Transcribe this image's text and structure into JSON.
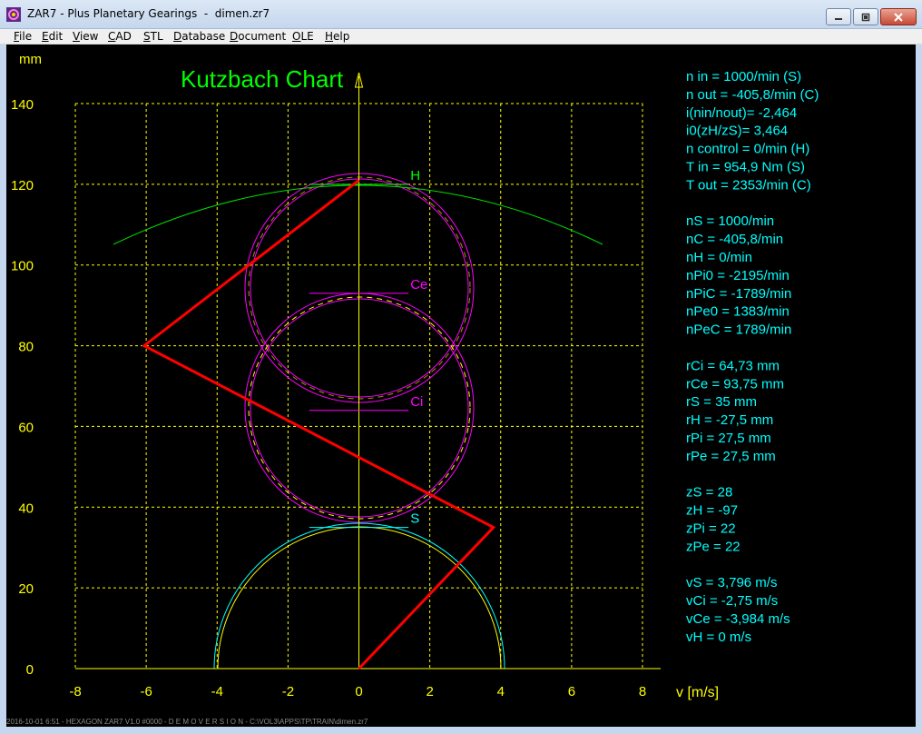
{
  "window": {
    "title": "ZAR7 - Plus Planetary Gearings  -  dimen.zr7",
    "icon": "app-icon",
    "controls": [
      "minimize-icon",
      "maximize-icon",
      "close-icon"
    ]
  },
  "menu": [
    "File",
    "Edit",
    "View",
    "CAD",
    "STL",
    "Database",
    "Document",
    "OLE",
    "Help"
  ],
  "chart_data": {
    "type": "line",
    "title": "Kutzbach Chart",
    "xlabel": "v [m/s]",
    "ylabel": "mm",
    "xlim": [
      -8,
      8
    ],
    "ylim": [
      0,
      140
    ],
    "xticks": [
      -8,
      -6,
      -4,
      -2,
      0,
      2,
      4,
      6,
      8
    ],
    "yticks": [
      0,
      20,
      40,
      60,
      80,
      100,
      120,
      140
    ],
    "grid": true,
    "series": [
      {
        "name": "",
        "color": "#ff0000",
        "points": [
          [
            0,
            0
          ],
          [
            3.796,
            35
          ],
          [
            -6.06,
            80
          ],
          [
            0,
            121
          ]
        ]
      }
    ],
    "labels": [
      {
        "text": "H",
        "color": "#00ff00",
        "x": 1.4,
        "y": 122
      },
      {
        "text": "Ce",
        "color": "#ff00ff",
        "x": 1.4,
        "y": 95
      },
      {
        "text": "Ci",
        "color": "#ff00ff",
        "x": 1.4,
        "y": 66
      },
      {
        "text": "S",
        "color": "#00ffff",
        "x": 1.4,
        "y": 37
      }
    ],
    "colors": {
      "grid": "#ffff00",
      "axes": "#ffff00",
      "title": "#00ff00",
      "info": "#00ffff"
    }
  },
  "info": {
    "group1": [
      "n in = 1000/min (S)",
      "n out = -405,8/min (C)",
      "i(nin/nout)= -2,464",
      "i0(zH/zS)= 3,464",
      "n control = 0/min (H)",
      "T in = 954,9 Nm (S)",
      "T out = 2353/min (C)"
    ],
    "group2": [
      "nS = 1000/min",
      "nC = -405,8/min",
      "nH = 0/min",
      "nPi0 = -2195/min",
      "nPiC = -1789/min",
      "nPe0 = 1383/min",
      "nPeC = 1789/min"
    ],
    "group3": [
      "rCi = 64,73 mm",
      "rCe = 93,75 mm",
      "rS = 35 mm",
      "rH = -27,5 mm",
      "rPi = 27,5 mm",
      "rPe = 27,5 mm"
    ],
    "group4": [
      "zS = 28",
      "zH = -97",
      "zPi = 22",
      "zPe = 22"
    ],
    "group5": [
      "vS = 3,796 m/s",
      "vCi = -2,75 m/s",
      "vCe = -3,984 m/s",
      "vH = 0 m/s"
    ]
  },
  "footer": "2016-10-01 6:51 - HEXAGON ZAR7 V1.0 #0000 - D E M O V E R S I O N - C:\\VOL3\\APPS\\TP\\TRAIN\\dimen.zr7"
}
